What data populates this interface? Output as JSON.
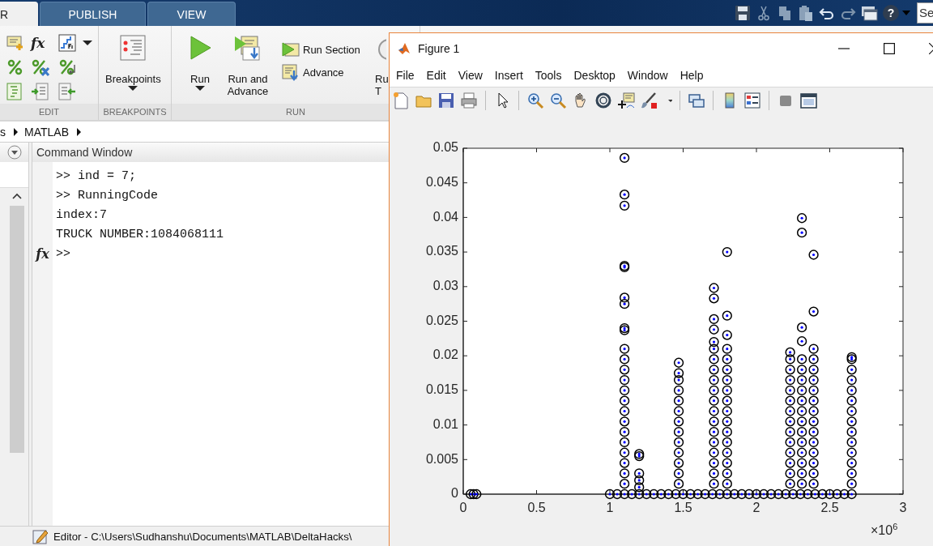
{
  "toolstrip": {
    "tabs": [
      {
        "label": "R",
        "selected": true
      },
      {
        "label": "PUBLISH",
        "selected": false
      },
      {
        "label": "VIEW",
        "selected": false
      }
    ],
    "help_label": "?",
    "search": {
      "value": "Se"
    }
  },
  "ribbon": {
    "edit": {
      "function_label": "fx",
      "title": "EDIT"
    },
    "breakpoints": {
      "label": "Breakpoints",
      "title": "BREAKPOINTS"
    },
    "run": {
      "run_label": "Run",
      "run_advance_label": "Run and Advance",
      "run_section_label": "Run Section",
      "advance_label": "Advance",
      "run_time_label": [
        "Ru",
        "T"
      ],
      "title": "RUN"
    }
  },
  "address_bar": {
    "segments": [
      "s",
      "MATLAB"
    ]
  },
  "command_window": {
    "title": "Command Window",
    "lines": [
      ">> ind = 7;",
      ">> RunningCode",
      "index:7",
      "TRUCK NUMBER:1084068111"
    ],
    "prompt_icon": "fx",
    "prompt": ">>"
  },
  "status_bar": {
    "text": "Editor - C:\\Users\\Sudhanshu\\Documents\\MATLAB\\DeltaHacks\\"
  },
  "figure": {
    "title": "Figure 1",
    "menu": [
      "File",
      "Edit",
      "View",
      "Insert",
      "Tools",
      "Desktop",
      "Window",
      "Help"
    ],
    "x_exponent": "×10$^{6}$",
    "chart_data": {
      "type": "scatter",
      "xlim": [
        0,
        3
      ],
      "ylim": [
        0,
        0.05
      ],
      "xticks": [
        0,
        0.5,
        1,
        1.5,
        2,
        2.5,
        3
      ],
      "yticks": [
        0,
        0.005,
        0.01,
        0.015,
        0.02,
        0.025,
        0.03,
        0.035,
        0.04,
        0.045,
        0.05
      ],
      "x": [
        0.05,
        0.07,
        0.09,
        1,
        1.05,
        1.1,
        1.15,
        1.2,
        1.25,
        1.3,
        1.35,
        1.4,
        1.45,
        1.5,
        1.55,
        1.6,
        1.65,
        1.7,
        1.75,
        1.8,
        1.85,
        1.9,
        1.95,
        2,
        2.05,
        2.1,
        2.15,
        2.2,
        2.25,
        2.3,
        2.35,
        2.4,
        2.45,
        2.5,
        2.55,
        2.6,
        2.65,
        1.1,
        1.1,
        1.1,
        1.1,
        1.1,
        1.1,
        1.1,
        1.1,
        1.1,
        1.1,
        1.1,
        1.1,
        1.1,
        1.1,
        1.1,
        1.1,
        1.1,
        1.1,
        1.1,
        1.1,
        1.1,
        1.1,
        1.1,
        1.2,
        1.2,
        1.2,
        1.2,
        1.2,
        1.47,
        1.47,
        1.47,
        1.47,
        1.47,
        1.47,
        1.47,
        1.47,
        1.47,
        1.47,
        1.47,
        1.47,
        1.47,
        1.71,
        1.71,
        1.71,
        1.71,
        1.71,
        1.71,
        1.71,
        1.71,
        1.71,
        1.71,
        1.71,
        1.71,
        1.71,
        1.71,
        1.71,
        1.71,
        1.71,
        1.71,
        1.71,
        1.8,
        1.8,
        1.8,
        1.8,
        1.8,
        1.8,
        1.8,
        1.8,
        1.8,
        1.8,
        1.8,
        1.8,
        1.8,
        1.8,
        1.8,
        1.8,
        1.8,
        2.23,
        2.23,
        2.23,
        2.23,
        2.23,
        2.23,
        2.23,
        2.23,
        2.23,
        2.23,
        2.23,
        2.23,
        2.23,
        2.23,
        2.31,
        2.31,
        2.31,
        2.31,
        2.31,
        2.31,
        2.31,
        2.31,
        2.31,
        2.31,
        2.31,
        2.31,
        2.31,
        2.31,
        2.31,
        2.31,
        2.31,
        2.39,
        2.39,
        2.39,
        2.39,
        2.39,
        2.39,
        2.39,
        2.39,
        2.39,
        2.39,
        2.39,
        2.39,
        2.39,
        2.39,
        2.39,
        2.39,
        2.65,
        2.65,
        2.65,
        2.65,
        2.65,
        2.65,
        2.65,
        2.65,
        2.65,
        2.65,
        2.65,
        2.65,
        2.65,
        2.65
      ],
      "series": [
        {
          "color": "#000000",
          "values": [
            0,
            0,
            0,
            0,
            0,
            0,
            0,
            0,
            0,
            0,
            0,
            0,
            0,
            0,
            0,
            0,
            0,
            0,
            0,
            0,
            0,
            0,
            0,
            0,
            0,
            0,
            0,
            0,
            0,
            0,
            0,
            0,
            0,
            0,
            0,
            0,
            0,
            0.0015,
            0.003,
            0.0045,
            0.006,
            0.0075,
            0.009,
            0.0105,
            0.012,
            0.0135,
            0.015,
            0.0165,
            0.018,
            0.0195,
            0.021,
            0.0237,
            0.024,
            0.0275,
            0.0284,
            0.0328,
            0.033,
            0.0417,
            0.0433,
            0.0486,
            0.001,
            0.002,
            0.003,
            0.0055,
            0.0058,
            0.0015,
            0.003,
            0.0045,
            0.006,
            0.0075,
            0.009,
            0.0105,
            0.012,
            0.0135,
            0.015,
            0.0165,
            0.0175,
            0.019,
            0.0015,
            0.003,
            0.0045,
            0.006,
            0.0075,
            0.009,
            0.0105,
            0.012,
            0.0135,
            0.015,
            0.0165,
            0.018,
            0.0195,
            0.021,
            0.022,
            0.0238,
            0.0253,
            0.0283,
            0.0298,
            0.0015,
            0.003,
            0.0045,
            0.006,
            0.0075,
            0.009,
            0.0105,
            0.012,
            0.0135,
            0.015,
            0.0165,
            0.018,
            0.0195,
            0.021,
            0.023,
            0.0258,
            0.035,
            0.0015,
            0.003,
            0.0045,
            0.006,
            0.0075,
            0.009,
            0.0105,
            0.012,
            0.0135,
            0.015,
            0.0165,
            0.018,
            0.0195,
            0.0205,
            0.0015,
            0.003,
            0.0045,
            0.006,
            0.0075,
            0.009,
            0.0105,
            0.012,
            0.0135,
            0.015,
            0.0165,
            0.018,
            0.0195,
            0.0221,
            0.0241,
            0.0378,
            0.0399,
            0.0015,
            0.003,
            0.0045,
            0.006,
            0.0075,
            0.009,
            0.0105,
            0.012,
            0.0135,
            0.015,
            0.0165,
            0.018,
            0.0195,
            0.021,
            0.0264,
            0.0346,
            0.0015,
            0.003,
            0.0045,
            0.006,
            0.0075,
            0.009,
            0.0105,
            0.012,
            0.0135,
            0.015,
            0.0165,
            0.018,
            0.0195,
            0.0198
          ]
        }
      ]
    }
  }
}
